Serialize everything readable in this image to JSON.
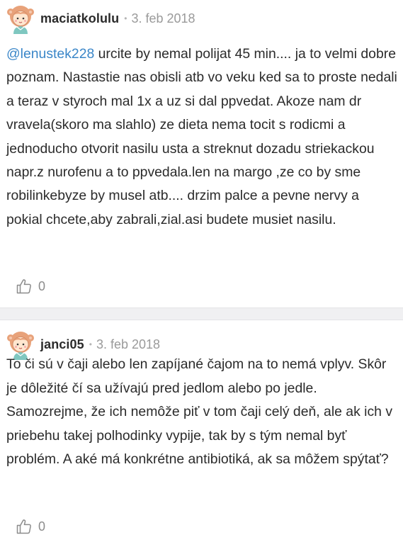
{
  "comments": [
    {
      "username": "maciatkolulu",
      "separator_dot": "•",
      "date": "3. feb 2018",
      "mention": "@lenustek228",
      "text": " urcite by nemal polijat 45 min.... ja to velmi dobre poznam. Nastastie nas obisli atb vo veku ked sa to proste nedali a teraz v styroch mal 1x a uz si dal ppvedat. Akoze nam dr vravela(skoro ma slahlo) ze dieta nema tocit s rodicmi a jednoducho otvorit nasilu usta a streknut dozadu striekackou napr.z nurofenu a to ppvedala.len na margo ,ze co by sme robilinkebyze by musel atb.... drzim palce a pevne nervy a pokial chcete,aby zabrali,zial.asi budete musiet nasilu.",
      "likes": "0",
      "avatar_icon": "girl-avatar-icon",
      "like_icon": "thumbs-up-icon"
    },
    {
      "username": "janci05",
      "separator_dot": "•",
      "date": "3. feb 2018",
      "text": "To či sú v čaji alebo len zapíjané čajom na to nemá vplyv. Skôr je dôležité čí sa užívajú pred jedlom alebo po jedle. Samozrejme, že ich nemôže piť v tom čaji celý deň, ale ak ich v priebehu takej polhodinky vypije, tak by s tým nemal byť problém. A aké má konkrétne antibiotiká, ak sa môžem spýtať?",
      "likes": "0",
      "avatar_icon": "girl-avatar-icon",
      "like_icon": "thumbs-up-icon"
    }
  ],
  "colors": {
    "mention": "#3a86c8",
    "text": "#2b2b2b",
    "meta": "#9a9a9a",
    "separator_bg": "#f0f0f2",
    "avatar_hair": "#e8a27a",
    "avatar_skin": "#ffe6cf"
  }
}
